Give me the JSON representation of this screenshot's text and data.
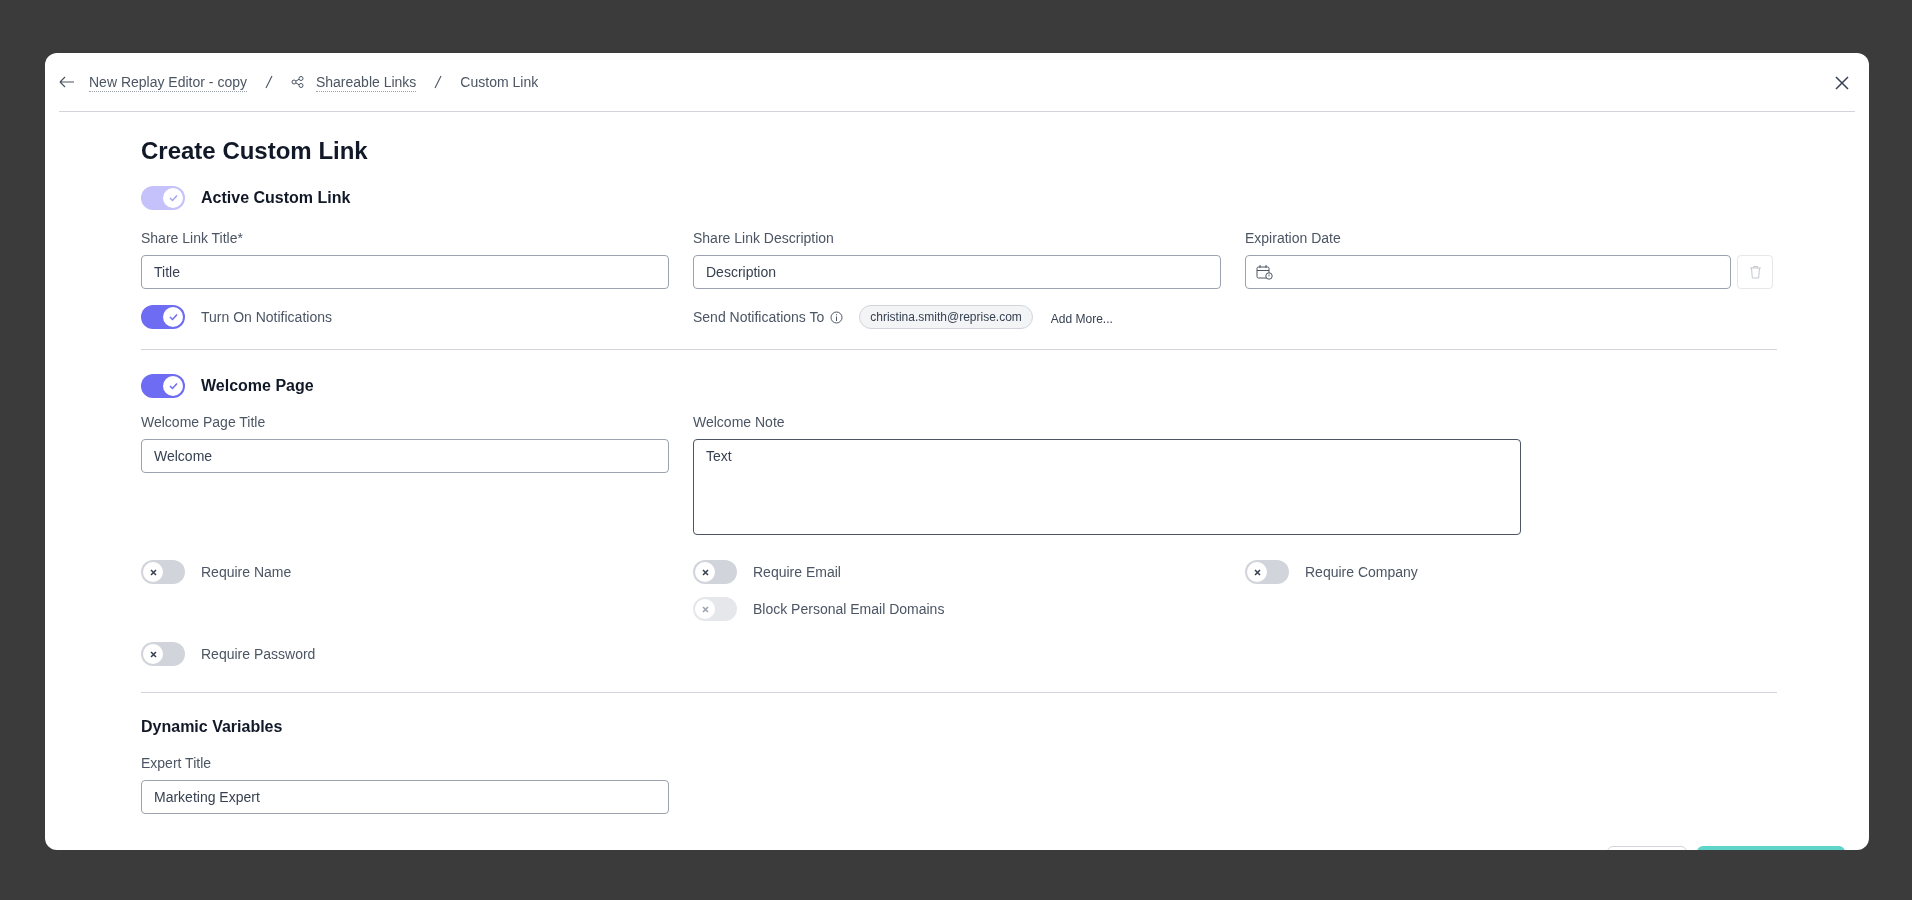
{
  "breadcrumb": [
    {
      "label": "New Replay Editor - copy",
      "kind": "back"
    },
    {
      "label": "Shareable Links",
      "kind": "share"
    },
    {
      "label": "Custom Link",
      "kind": "current"
    }
  ],
  "title": "Create Custom Link",
  "active_toggle": {
    "label": "Active Custom Link",
    "on": true,
    "disabled": true
  },
  "fields": [
    {
      "label": "Share Link Title*",
      "value": "Title",
      "kind": "text"
    },
    {
      "label": "Share Link Description",
      "value": "Description",
      "kind": "text"
    },
    {
      "label": "Expiration Date",
      "kind": "date"
    }
  ],
  "notifications_toggle": {
    "label": "Turn On Notifications",
    "on": true,
    "disabled": false
  },
  "send_to": {
    "label": "Send Notifications To",
    "chips": [
      "christina.smith@reprise.com"
    ],
    "add_more": "Add More..."
  },
  "welcome_toggle": {
    "label": "Welcome Page",
    "on": true,
    "disabled": false
  },
  "welcome_title": {
    "label": "Welcome Page Title",
    "value": "Welcome"
  },
  "welcome_note": {
    "label": "Welcome Note",
    "value": "Text"
  },
  "requirement_columns": [
    [
      {
        "label": "Require Name",
        "on": false,
        "disabled": false
      },
      {
        "label": "Require Password",
        "on": false,
        "disabled": false
      }
    ],
    [
      {
        "label": "Require Email",
        "on": false,
        "disabled": false
      },
      {
        "label": "Block Personal Email Domains",
        "on": false,
        "disabled": true
      }
    ],
    [
      {
        "label": "Require Company",
        "on": false,
        "disabled": false
      }
    ]
  ],
  "dynamic_variables": {
    "title": "Dynamic Variables",
    "fields": [
      {
        "label": "Expert Title",
        "value": "Marketing Expert"
      }
    ]
  }
}
